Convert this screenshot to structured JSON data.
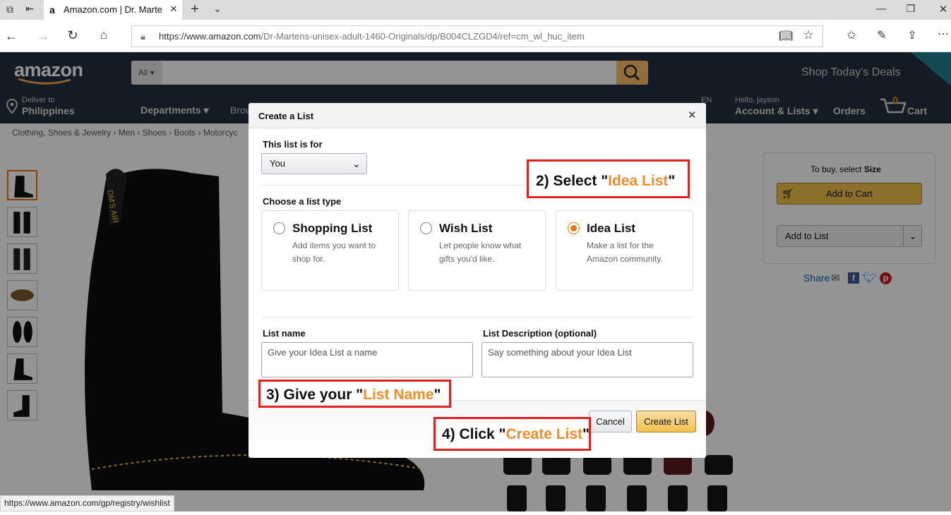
{
  "browser": {
    "tab_title": "Amazon.com | Dr. Marte",
    "url_prefix": "https://www.amazon.com",
    "url_rest": "/Dr-Martens-unisex-adult-1460-Originals/dp/B004CLZGD4/ref=cm_wl_huc_item",
    "status_url": "https://www.amazon.com/gp/registry/wishlist"
  },
  "header": {
    "logo": "amazon",
    "search_category": "All",
    "promo": "Shop Today's Deals",
    "deliver_label": "Deliver to",
    "deliver_location": "Philippines",
    "departments": "Departments",
    "browse_partial": "Brow",
    "lang": "EN",
    "greeting": "Hello, jayson",
    "account": "Account & Lists",
    "orders": "Orders",
    "cart_count": "0",
    "cart": "Cart"
  },
  "breadcrumb": [
    "Clothing, Shoes & Jewelry",
    "Men",
    "Shoes",
    "Boots",
    "Motorcyc"
  ],
  "buybox": {
    "select_prefix": "To buy, select ",
    "select_field": "Size",
    "add_to_cart": "Add to Cart",
    "add_to_list": "Add to List",
    "share": "Share"
  },
  "modal": {
    "title": "Create a List",
    "list_for_label": "This list is for",
    "list_for_value": "You",
    "list_type_label": "Choose a list type",
    "types": [
      {
        "title": "Shopping List",
        "desc": "Add items you want to shop for.",
        "selected": false
      },
      {
        "title": "Wish List",
        "desc": "Let people know what gifts you'd like.",
        "selected": false
      },
      {
        "title": "Idea List",
        "desc": "Make a list for the Amazon community.",
        "selected": true
      }
    ],
    "name_label": "List name",
    "name_placeholder": "Give your Idea List a name",
    "desc_label": "List Description (optional)",
    "desc_placeholder": "Say something about your Idea List",
    "cancel": "Cancel",
    "create": "Create List"
  },
  "annotations": {
    "a2_pre": "2) Select \"",
    "a2_hl": "Idea List",
    "a2_post": "\"",
    "a3_pre": "3) Give your \"",
    "a3_hl": "List Name",
    "a3_post": "\"",
    "a4_pre": "4) Click \"",
    "a4_hl": "Create List",
    "a4_post": "\""
  },
  "colors": {
    "amazon_dark": "#232f3e",
    "search_button": "#febd69",
    "accent_orange": "#f08c2a",
    "annotation_red": "#dd2222",
    "create_button": "#f0c14b"
  }
}
